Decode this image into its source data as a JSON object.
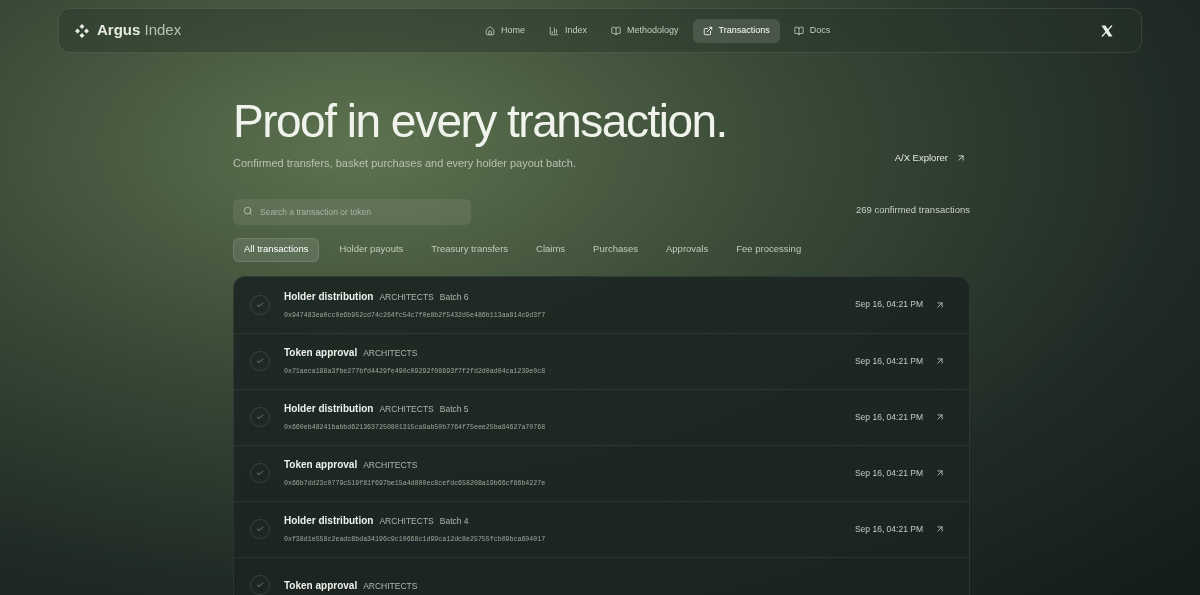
{
  "nav": {
    "brand": {
      "name": "Argus",
      "suffix": "Index"
    },
    "links": [
      {
        "label": "Home",
        "kind": "home",
        "selected": false
      },
      {
        "label": "Index",
        "kind": "chart",
        "selected": false
      },
      {
        "label": "Methodology",
        "kind": "book",
        "selected": false
      },
      {
        "label": "Transactions",
        "kind": "external",
        "selected": true
      },
      {
        "label": "Docs",
        "kind": "book",
        "selected": false
      }
    ]
  },
  "hero": {
    "title": "Proof in every transaction.",
    "subtitle": "Confirmed transfers, basket purchases and every holder payout batch.",
    "explorer_link": "A/X Explorer"
  },
  "search": {
    "placeholder": "Search a transaction or token"
  },
  "count": "269 confirmed transactions",
  "filters": [
    {
      "label": "All transactions",
      "selected": true
    },
    {
      "label": "Holder payouts",
      "selected": false
    },
    {
      "label": "Treasury transfers",
      "selected": false
    },
    {
      "label": "Claims",
      "selected": false
    },
    {
      "label": "Purchases",
      "selected": false
    },
    {
      "label": "Approvals",
      "selected": false
    },
    {
      "label": "Fee processing",
      "selected": false
    }
  ],
  "transactions": [
    {
      "title": "Holder distribution",
      "token": "ARCHITECTS",
      "batch": "Batch 6",
      "hash": "0x947483ea0cc0e6b952cd74c264fc54c7f0e8b2f5432d5e486b113aa814c9d3f7",
      "time": "Sep 16, 04:21 PM"
    },
    {
      "title": "Token approval",
      "token": "ARCHITECTS",
      "hash": "0x71aeca198a3fbe277bfd4429fe490c09292f08693f7f2fd2d0ad04ca1239e0c8",
      "time": "Sep 16, 04:21 PM"
    },
    {
      "title": "Holder distribution",
      "token": "ARCHITECTS",
      "batch": "Batch 5",
      "hash": "0x660eb48241babbd6213637250801315ca9ab50b7764f75eee25ba84627a70768",
      "time": "Sep 16, 04:21 PM"
    },
    {
      "title": "Token approval",
      "token": "ARCHITECTS",
      "hash": "0x66b7dd23c0779c519f81f697be15a4d800ec8cefdc658208a19b66cf86b4227e",
      "time": "Sep 16, 04:21 PM"
    },
    {
      "title": "Holder distribution",
      "token": "ARCHITECTS",
      "batch": "Batch 4",
      "hash": "0xf38d1e558c2eadc8bda34196c9c10668c1d99ca12dc8e25755fcb09bca604017",
      "time": "Sep 16, 04:21 PM"
    },
    {
      "title": "Token approval",
      "token": "ARCHITECTS"
    }
  ]
}
